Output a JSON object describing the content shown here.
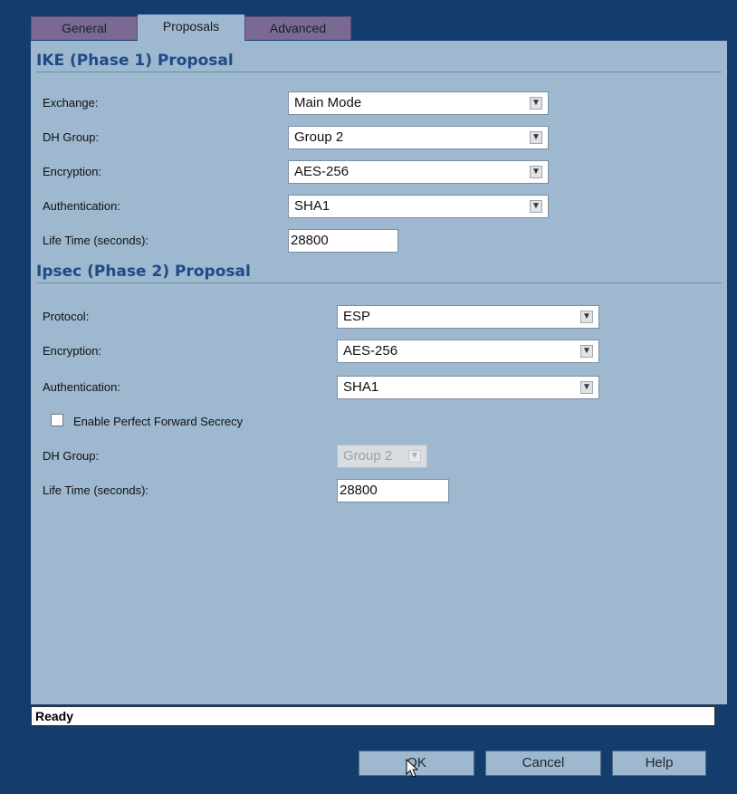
{
  "tabs": [
    {
      "label": "General"
    },
    {
      "label": "Proposals"
    },
    {
      "label": "Advanced"
    }
  ],
  "ike": {
    "title": "IKE (Phase 1) Proposal",
    "exchange_label": "Exchange:",
    "exchange_value": "Main Mode",
    "dh_label": "DH Group:",
    "dh_value": "Group 2",
    "enc_label": "Encryption:",
    "enc_value": "AES-256",
    "auth_label": "Authentication:",
    "auth_value": "SHA1",
    "life_label": "Life Time (seconds):",
    "life_value": "28800"
  },
  "ipsec": {
    "title": "Ipsec (Phase 2) Proposal",
    "protocol_label": "Protocol:",
    "protocol_value": "ESP",
    "enc_label": "Encryption:",
    "enc_value": "AES-256",
    "auth_label": "Authentication:",
    "auth_value": "SHA1",
    "pfs_label": "Enable Perfect Forward Secrecy",
    "pfs_checked": false,
    "dh_label": "DH Group:",
    "dh_value": "Group 2",
    "life_label": "Life Time (seconds):",
    "life_value": "28800"
  },
  "status": "Ready",
  "buttons": {
    "ok": "OK",
    "cancel": "Cancel",
    "help": "Help"
  },
  "icons": {
    "dropdown": "chevron-down-icon",
    "cursor": "pointer-cursor-icon"
  },
  "colors": {
    "background": "#143d6e",
    "panel": "#9db8cf",
    "tab_inactive": "#7a6a93",
    "section_title": "#1f4a87"
  }
}
